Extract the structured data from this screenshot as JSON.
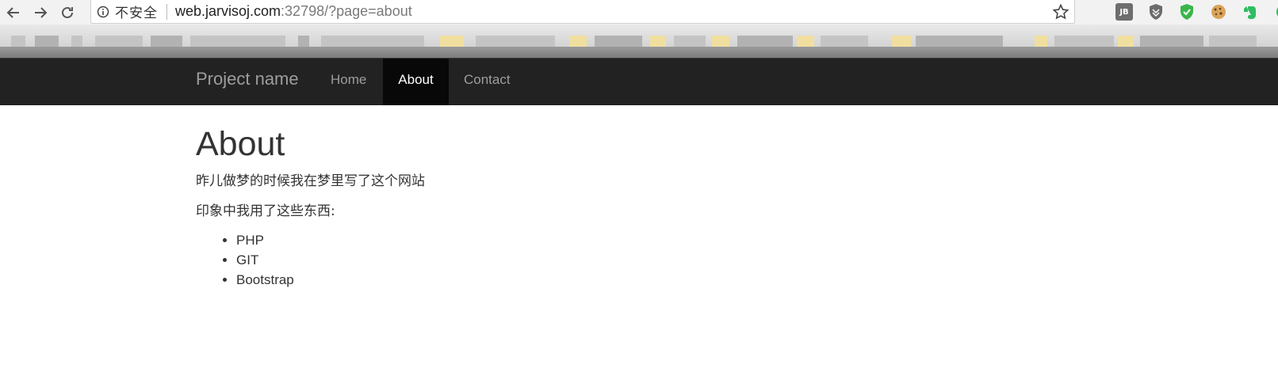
{
  "browser": {
    "security_label": "不安全",
    "url_host": "web.jarvisoj.com",
    "url_rest": ":32798/?page=about",
    "extensions": [
      {
        "name": "jetbrains-extension",
        "label": "JB"
      },
      {
        "name": "shield-extension"
      },
      {
        "name": "green-check-extension"
      },
      {
        "name": "cookie-extension"
      },
      {
        "name": "evernote-extension"
      }
    ]
  },
  "navbar": {
    "brand": "Project name",
    "links": [
      {
        "label": "Home",
        "active": false
      },
      {
        "label": "About",
        "active": true
      },
      {
        "label": "Contact",
        "active": false
      }
    ],
    "background": "#222222",
    "active_background": "#080808"
  },
  "main": {
    "title": "About",
    "paragraphs": [
      "昨儿做梦的时候我在梦里写了这个网站",
      "印象中我用了这些东西:"
    ],
    "items": [
      "PHP",
      "GIT",
      "Bootstrap"
    ]
  }
}
